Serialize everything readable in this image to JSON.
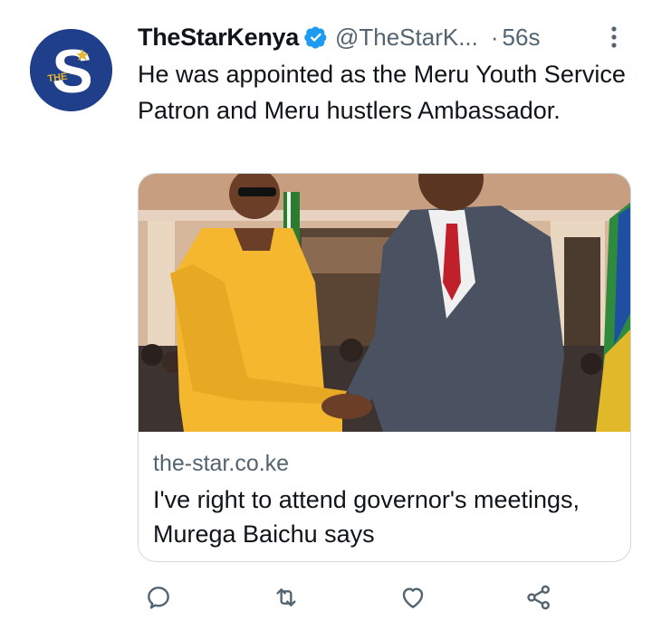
{
  "tweet": {
    "display_name": "TheStarKenya",
    "handle": "@TheStarK...",
    "separator": "·",
    "timestamp": "56s",
    "text": "He was appointed as the Meru Youth Service Patron and Meru hustlers Ambassador.",
    "avatar_letter": "S",
    "avatar_label": "THE"
  },
  "card": {
    "domain": "the-star.co.ke",
    "title": "I've right to attend governor's meetings, Murega Baichu says"
  },
  "actions": {
    "reply_icon": "reply-icon",
    "retweet_icon": "retweet-icon",
    "like_icon": "heart-icon",
    "share_icon": "share-icon"
  },
  "colors": {
    "brand_blue": "#1d9bf0",
    "avatar_bg": "#1f3f8a",
    "muted": "#536471"
  }
}
